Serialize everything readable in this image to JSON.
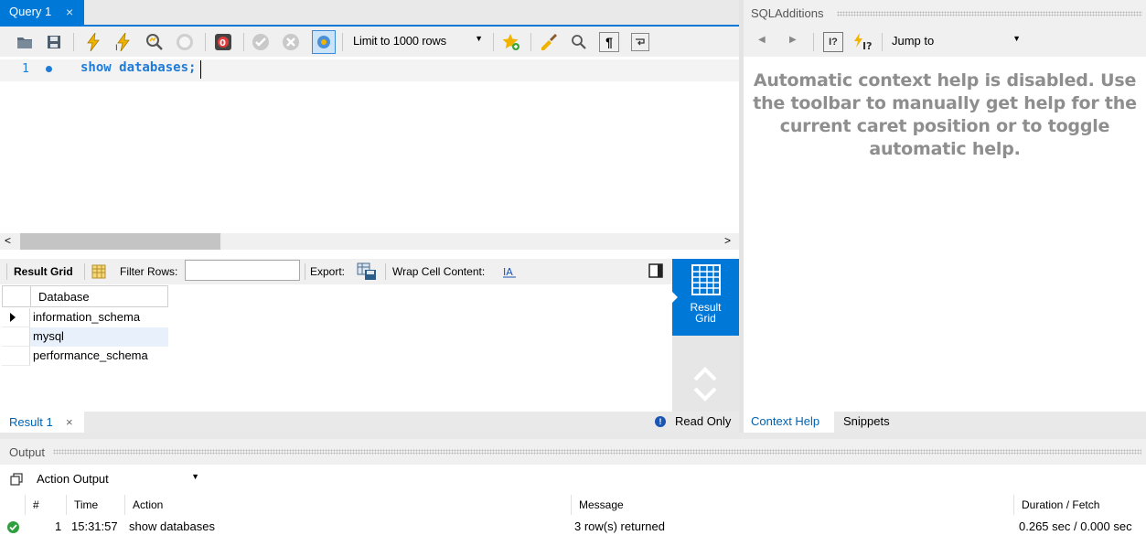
{
  "query_tab": {
    "label": "Query 1",
    "close": "×"
  },
  "query_toolbar": {
    "limit_select": {
      "value": "Limit to 1000 rows"
    }
  },
  "editor": {
    "line_number": "1",
    "code": "show databases;"
  },
  "result_toolbar": {
    "result_grid_label": "Result Grid",
    "filter_rows_label": "Filter Rows:",
    "filter_rows_value": "",
    "export_label": "Export:",
    "wrap_label": "Wrap Cell Content:"
  },
  "result_grid": {
    "column": "Database",
    "rows": [
      "information_schema",
      "mysql",
      "performance_schema"
    ]
  },
  "side_panel": {
    "result_grid_button": "Result\nGrid"
  },
  "result_tab": {
    "label": "Result 1",
    "close": "×",
    "read_only": "Read Only"
  },
  "sql_additions": {
    "title": "SQLAdditions",
    "jump_to": "Jump to",
    "help_text": "Automatic context help is disabled. Use the toolbar to manually get help for the current caret position or to toggle automatic help.",
    "tabs": [
      "Context Help",
      "Snippets"
    ]
  },
  "output": {
    "title": "Output",
    "select_value": "Action Output",
    "columns": [
      "#",
      "Time",
      "Action",
      "Message",
      "Duration / Fetch"
    ],
    "rows": [
      {
        "num": "1",
        "time": "15:31:57",
        "action": "show databases",
        "message": "3 row(s) returned",
        "duration": "0.265 sec / 0.000 sec",
        "status": "success"
      }
    ]
  },
  "colors": {
    "accent": "#0078d7",
    "code": "#1e7bd6",
    "help_text": "#8e8e8e",
    "success": "#2e9e3e"
  }
}
